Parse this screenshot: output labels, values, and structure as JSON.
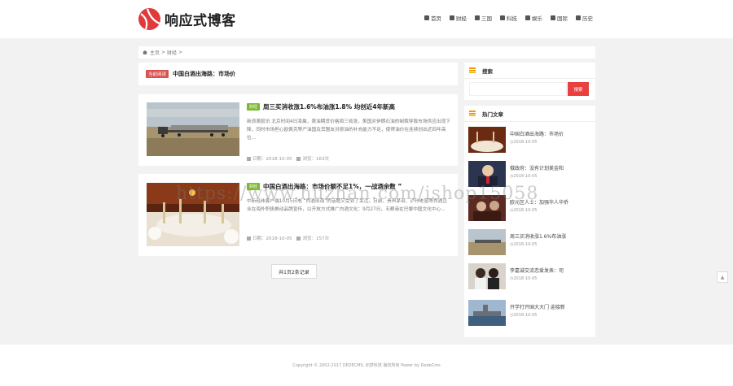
{
  "site": {
    "name": "响应式博客"
  },
  "nav": [
    {
      "label": "首页",
      "icon": "home-icon"
    },
    {
      "label": "财经",
      "icon": "chart-icon"
    },
    {
      "label": "三国",
      "icon": "book-icon"
    },
    {
      "label": "科技",
      "icon": "monitor-icon"
    },
    {
      "label": "娱乐",
      "icon": "chat-icon"
    },
    {
      "label": "国际",
      "icon": "user-icon"
    },
    {
      "label": "历史",
      "icon": "clock-icon"
    }
  ],
  "breadcrumb": {
    "home": "主页",
    "sep": ">",
    "current": "财经",
    "trail": ">"
  },
  "category": {
    "tag": "当前阅读",
    "title": "中国白酒出海路：市场价"
  },
  "posts": [
    {
      "tag": "财经",
      "title": "周三买消收涨1.6%布油涨1.8% 均创近4年新高",
      "excerpt": "新浪美股讯 北京时间4日凌晨，美油期货价格周三收涨，美国对伊朗石油的制裁导致市场供应出现下降，同时市场担心欧佩克等产油国及其盟友对原油的补充能力不足，使得油价在连续创出近四年高位...",
      "date": "日期：2018-10-05",
      "views": "浏览：163次",
      "date_icon": "calendar-icon",
      "views_icon": "eye-icon"
    },
    {
      "tag": "财经",
      "title": "中国白酒出海路：市场价额不足1%，一战酒余数 ”",
      "excerpt": "中新经纬客户端10月5日电 “白酒出海”的话题又受到了关注。日前，贵州茅台、泸州老窖等白酒企业在海外积极推动品牌宣传，以开放方式推广白酒文化：9月27日，五粮液在巴黎中国文化中心...",
      "date": "日期：2018-10-05",
      "views": "浏览：157次",
      "date_icon": "calendar-icon",
      "views_icon": "eye-icon"
    }
  ],
  "pager": {
    "label": "共1页2条记录"
  },
  "sidebar": {
    "search": {
      "title": "搜索",
      "placeholder": "",
      "button": "搜索"
    },
    "hot": {
      "title": "热门文章",
      "items": [
        {
          "title": "中国白酒出海路：市场价",
          "date": "2018-10-05"
        },
        {
          "title": "俄政府：没有计划美金和",
          "date": "2018-10-05"
        },
        {
          "title": "欧元区人士：加强华人华侨",
          "date": "2018-10-05"
        },
        {
          "title": "周三买消收涨1.6%布油涨",
          "date": "2018-10-05"
        },
        {
          "title": "李嘉诚交流恋爱发表：司",
          "date": "2018-10-05"
        },
        {
          "title": "开学打开国大大门 迎接新",
          "date": "2018-10-05"
        }
      ]
    }
  },
  "watermark": "https://www.huzhan.com/ishop15058",
  "footer": {
    "text": "Copyright © 2002-2017 DEDECMS. 织梦科技 版权所有 Power by DedeCms"
  },
  "colors": {
    "accent_red": "#e8403e",
    "tag_green": "#7cb82f",
    "orange": "#f39800"
  }
}
